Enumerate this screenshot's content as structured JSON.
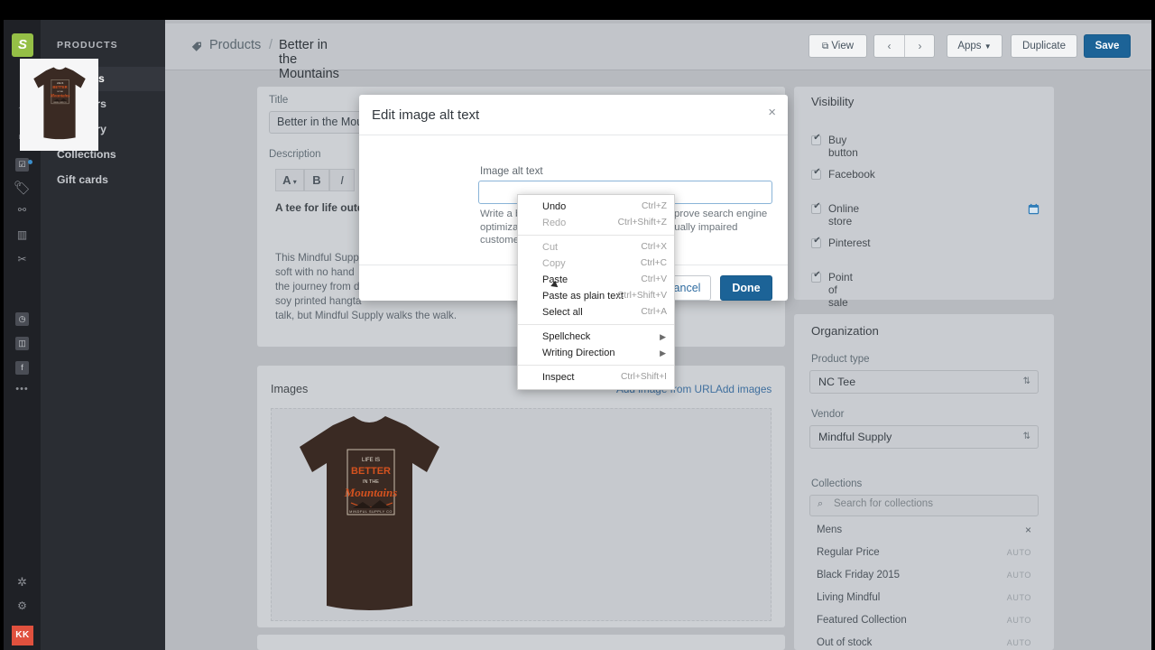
{
  "rail": {
    "logo": "shopify-logo",
    "icons": [
      {
        "name": "search-icon",
        "glyph": "⌕"
      },
      {
        "name": "home-icon",
        "glyph": "⌂"
      },
      {
        "name": "orders-icon",
        "glyph": "▣"
      },
      {
        "name": "products-tag-icon",
        "glyph": "🏷"
      },
      {
        "name": "customers-icon",
        "glyph": "⚲"
      },
      {
        "name": "analytics-icon",
        "glyph": "▥"
      },
      {
        "name": "discounts-icon",
        "glyph": "✂"
      },
      {
        "name": "clock-icon",
        "glyph": "◷"
      },
      {
        "name": "code-icon",
        "glyph": "</>"
      },
      {
        "name": "facebook-icon",
        "glyph": "f"
      },
      {
        "name": "more-icon",
        "glyph": "•••"
      },
      {
        "name": "apps-icon",
        "glyph": "✲"
      },
      {
        "name": "settings-gear-icon",
        "glyph": "⚙"
      }
    ],
    "avatar_initials": "KK"
  },
  "sidebar": {
    "title": "PRODUCTS",
    "items": [
      {
        "label": "Products",
        "active": true
      },
      {
        "label": "Transfers",
        "active": false
      },
      {
        "label": "Inventory",
        "active": false
      },
      {
        "label": "Collections",
        "active": false
      },
      {
        "label": "Gift cards",
        "active": false
      }
    ]
  },
  "topbar": {
    "breadcrumb_parent": "Products",
    "breadcrumb_separator": "/",
    "breadcrumb_current": "Better in the Mountains",
    "view_label": "View",
    "prev_label": "‹",
    "next_label": "›",
    "apps_label": "Apps",
    "apps_caret": "▾",
    "duplicate_label": "Duplicate",
    "save_label": "Save"
  },
  "product_form": {
    "title_label": "Title",
    "title_value": "Better in the Mountains",
    "description_label": "Description",
    "toolbar": [
      {
        "name": "font-style-button",
        "label": "A",
        "caret": "▾"
      },
      {
        "name": "bold-button",
        "label": "B"
      },
      {
        "name": "italic-button",
        "label": "I"
      }
    ],
    "desc_heading": "A tee for life outdoors",
    "desc_lines": [
      "This Mindful Suppl",
      "soft with no hand",
      "the journey from di",
      "soy printed hangta",
      "talk, but Mindful Supply walks the walk."
    ]
  },
  "images_card": {
    "title": "Images",
    "add_from_url": "Add image from URL",
    "add_images": "Add images",
    "tee_text": {
      "line1": "LIFE IS",
      "line2": "BETTER",
      "line3": "IN THE",
      "line4": "Mountains",
      "line5": "MINDFUL SUPPLY CO"
    }
  },
  "modal": {
    "title": "Edit image alt text",
    "close_glyph": "×",
    "alt_label": "Image alt text",
    "alt_value": "",
    "alt_placeholder": "",
    "help_text": "Write a brief description of this image to improve search engine optimization (SEO) and accessibility for visually impaired customers.",
    "cancel_label": "Cancel",
    "done_label": "Done"
  },
  "context_menu": {
    "groups": [
      [
        {
          "label": "Undo",
          "accel": "Ctrl+Z",
          "disabled": false
        },
        {
          "label": "Redo",
          "accel": "Ctrl+Shift+Z",
          "disabled": true
        }
      ],
      [
        {
          "label": "Cut",
          "accel": "Ctrl+X",
          "disabled": true
        },
        {
          "label": "Copy",
          "accel": "Ctrl+C",
          "disabled": true
        },
        {
          "label": "Paste",
          "accel": "Ctrl+V",
          "disabled": false
        },
        {
          "label": "Paste as plain text",
          "accel": "Ctrl+Shift+V",
          "disabled": false
        },
        {
          "label": "Select all",
          "accel": "Ctrl+A",
          "disabled": false
        }
      ],
      [
        {
          "label": "Spellcheck",
          "accel": "",
          "submenu": true,
          "disabled": false
        },
        {
          "label": "Writing Direction",
          "accel": "",
          "submenu": true,
          "disabled": false
        }
      ],
      [
        {
          "label": "Inspect",
          "accel": "Ctrl+Shift+I",
          "disabled": false
        }
      ]
    ]
  },
  "visibility": {
    "title": "Visibility",
    "items": [
      {
        "label": "Buy button",
        "checked": true,
        "calendar": false
      },
      {
        "label": "Facebook",
        "checked": true,
        "calendar": false
      },
      {
        "label": "Online store",
        "checked": true,
        "calendar": true
      },
      {
        "label": "Pinterest",
        "checked": true,
        "calendar": false
      },
      {
        "label": "Point of sale",
        "checked": true,
        "calendar": false
      }
    ]
  },
  "organization": {
    "title": "Organization",
    "product_type_label": "Product type",
    "product_type_value": "NC Tee",
    "vendor_label": "Vendor",
    "vendor_value": "Mindful Supply",
    "collections_label": "Collections",
    "collections_placeholder": "Search for collections",
    "collections": [
      {
        "name": "Mens",
        "badge": "",
        "removable": true
      },
      {
        "name": "Regular Price",
        "badge": "AUTO",
        "removable": false
      },
      {
        "name": "Black Friday 2015",
        "badge": "AUTO",
        "removable": false
      },
      {
        "name": "Living Mindful",
        "badge": "AUTO",
        "removable": false
      },
      {
        "name": "Featured Collection",
        "badge": "AUTO",
        "removable": false
      },
      {
        "name": "Out of stock",
        "badge": "AUTO",
        "removable": false
      }
    ]
  },
  "colors": {
    "accent": "#1c6397",
    "rail_bg": "#1f2126",
    "nav_bg": "#2a2d33",
    "page_bg": "#b7babf",
    "avatar_bg": "#e0513e",
    "logo_green": "#95bf46"
  }
}
